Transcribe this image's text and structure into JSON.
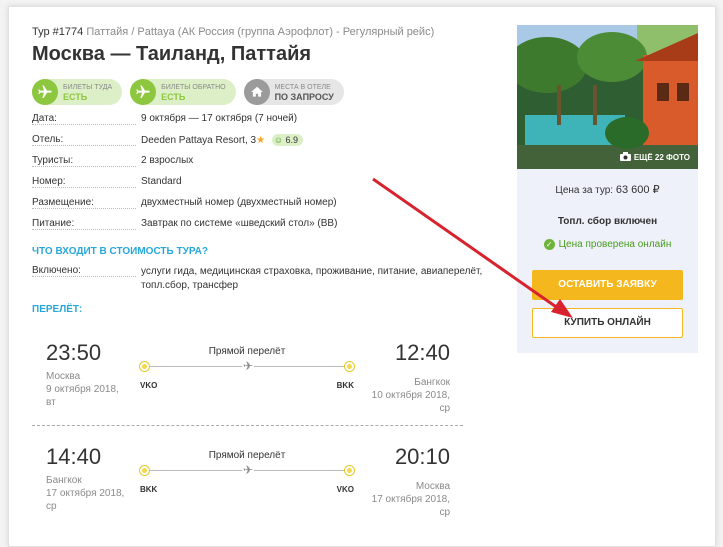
{
  "tour": {
    "number": "Тур #1774",
    "route_info": "Паттайя / Pattaya (АК Россия (группа Аэрофлот) - Регулярный рейс)",
    "title": "Москва  —  Таиланд, Паттайя"
  },
  "badges": [
    {
      "small": "Билеты туда",
      "big": "Есть",
      "icon": "plane-icon"
    },
    {
      "small": "Билеты обратно",
      "big": "Есть",
      "icon": "plane-icon"
    },
    {
      "small": "Места в отеле",
      "big": "По запросу",
      "icon": "house-icon"
    }
  ],
  "details": [
    {
      "key": "Дата:",
      "value": "9 октября — 17 октября (7 ночей)"
    },
    {
      "key": "Отель:",
      "value": "Deeden Pattaya Resort, 3",
      "rating": "6.9"
    },
    {
      "key": "Туристы:",
      "value": "2 взрослых"
    },
    {
      "key": "Номер:",
      "value": "Standard"
    },
    {
      "key": "Размещение:",
      "value": "двухместный номер (двухместный номер)"
    },
    {
      "key": "Питание:",
      "value": "Завтрак по системе «шведский стол» (BB)"
    }
  ],
  "included_link": "Что входит в стоимость тура?",
  "included": {
    "key": "Включено:",
    "value": "услуги гида, медицинская страховка, проживание, питание, авиаперелёт, топл.сбор, трансфер"
  },
  "flights_title": "Перелёт:",
  "flights": [
    {
      "dep_time": "23:50",
      "dep_city": "Москва",
      "dep_date": "9 октября 2018,",
      "dep_day": "вт",
      "label": "Прямой перелёт",
      "from_code": "VKO",
      "to_code": "BKK",
      "arr_time": "12:40",
      "arr_city": "Бангкок",
      "arr_date": "10 октября 2018,",
      "arr_day": "ср"
    },
    {
      "dep_time": "14:40",
      "dep_city": "Бангкок",
      "dep_date": "17 октября 2018,",
      "dep_day": "ср",
      "label": "Прямой перелёт",
      "from_code": "BKK",
      "to_code": "VKO",
      "arr_time": "20:10",
      "arr_city": "Москва",
      "arr_date": "17 октября 2018,",
      "arr_day": "ср"
    }
  ],
  "sidebar": {
    "photos": "Ещё 22 фото",
    "price_label": "Цена за тур:",
    "price_value": "63 600 ₽",
    "fee_included": "Топл. сбор включен",
    "price_checked": "Цена проверена онлайн",
    "order_button": "Оставить заявку",
    "buy_button": "Купить онлайн"
  },
  "colors": {
    "accent_blue": "#28a8d8",
    "green": "#8dc63f",
    "orange_button": "#f5b71e",
    "annotation_arrow": "#d8232f"
  }
}
